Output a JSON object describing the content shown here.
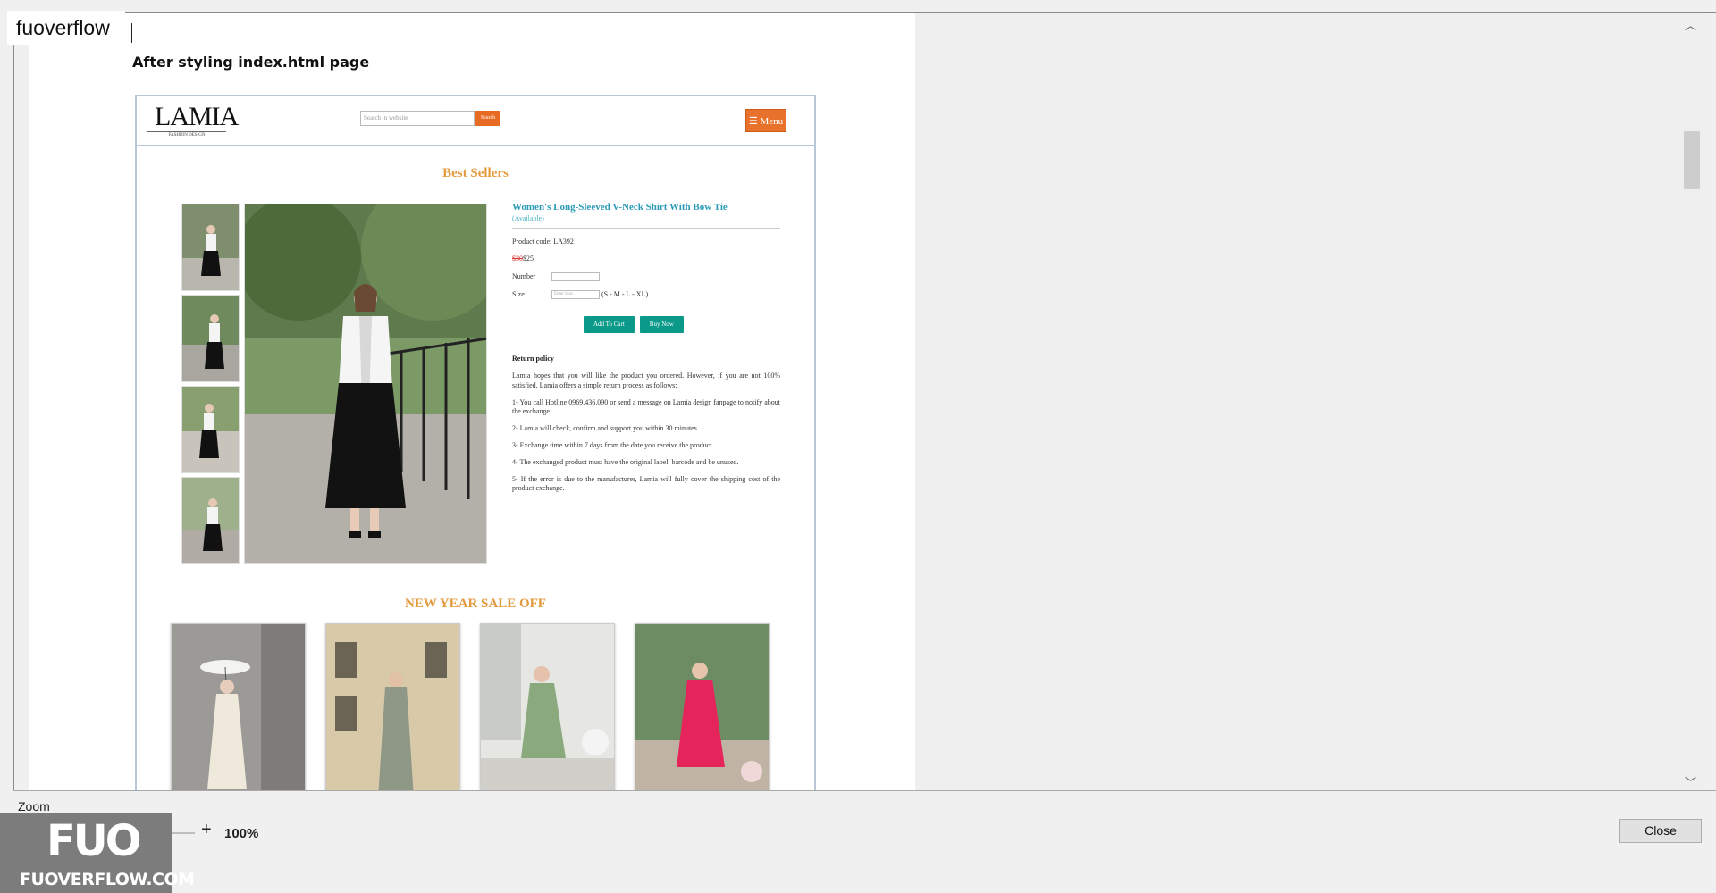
{
  "window": {
    "brand": "fuoverflow",
    "close_label": "Close"
  },
  "zoom": {
    "label": "Zoom",
    "minus": "-",
    "plus": "+",
    "value": "100%",
    "level_percent": 100
  },
  "watermark": {
    "logo": "FUO",
    "text": "FUOVERFLOW.COM"
  },
  "document": {
    "caption": "After styling index.html page"
  },
  "site": {
    "logo": "LAMIA",
    "logo_sub": "FASHION DESIGN",
    "search_placeholder": "Search in website",
    "search_button": "Search",
    "menu_button": "☰ Menu",
    "best_sellers": "Best Sellers",
    "product": {
      "title": "Women's Long-Sleeved V-Neck Shirt With Bow Tie",
      "availability": "(Available)",
      "code": "Product code: LA392",
      "old_price": "$30",
      "price": "$25",
      "number_label": "Number",
      "size_label": "Size",
      "size_placeholder": "Enter Size",
      "size_hint": "(S - M - L - XL)",
      "add_to_cart": "Add To Cart",
      "buy_now": "Buy Now"
    },
    "return_policy": {
      "title": "Return policy",
      "intro": "Lamia hopes that you will like the product you ordered. However, if you are not 100% satisfied, Lamia offers a simple return process as follows:",
      "items": [
        "1- You call Hotline 0969.436.090 or send a message on Lamia design fanpage to notify about the exchange.",
        "2- Lamia will check, confirm and support you within 30 minutes.",
        "3- Exchange time within 7 days from the date you receive the product.",
        "4- The exchanged product must have the original label, barcode and be unused.",
        "5- If the error is due to the manufacturer, Lamia will fully cover the shipping cost of the product exchange."
      ]
    },
    "new_year_title": "NEW YEAR SALE OFF"
  }
}
